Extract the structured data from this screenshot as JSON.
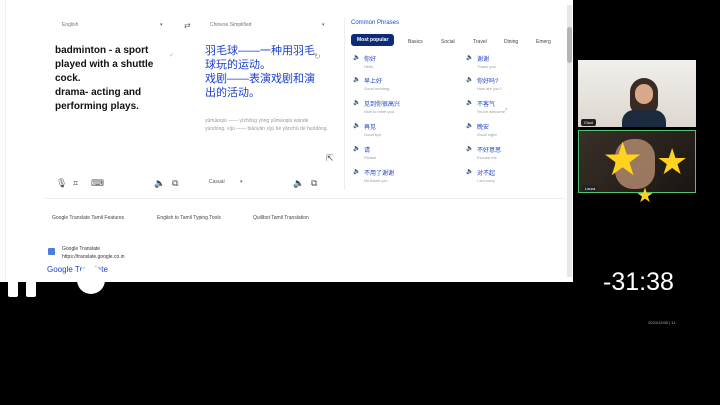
{
  "translator": {
    "source_lang": "English",
    "target_lang": "Chinese Simplified",
    "source_lines": [
      "badminton - a sport",
      "played with a shuttle",
      "cock.",
      "drama- acting and",
      "performing plays."
    ],
    "target_lines": [
      "羽毛球——一种用羽毛",
      "球玩的运动。",
      "戏剧——表演戏剧和演",
      "出的活动。"
    ],
    "romanization": "yǔmáoqiú —— yīzhǒng yòng yǔmáoqiú wánde yùndòng. xìjù —— biǎoyǎn xìjù hé yǎnchū de huódòng.",
    "tone": "Casual"
  },
  "phrases": {
    "title": "Common Phrases",
    "tabs": [
      "Most popular",
      "Basics",
      "Social",
      "Travel",
      "Dining",
      "Emerg"
    ],
    "items": [
      {
        "zh": "你好",
        "en": "Hello"
      },
      {
        "zh": "早上好",
        "en": "Good morning"
      },
      {
        "zh": "见到你很高兴",
        "en": "Nice to meet you"
      },
      {
        "zh": "再见",
        "en": "Good bye"
      },
      {
        "zh": "请",
        "en": "Please"
      },
      {
        "zh": "不用了谢谢",
        "en": "No thank you"
      },
      {
        "zh": "谢谢",
        "en": "Thank you"
      },
      {
        "zh": "你好吗?",
        "en": "How are you?"
      },
      {
        "zh": "不客气",
        "en": "You're welcome"
      },
      {
        "zh": "晚安",
        "en": "Good night"
      },
      {
        "zh": "不好意思",
        "en": "Excuse me"
      },
      {
        "zh": "对不起",
        "en": "I am sorry"
      }
    ]
  },
  "footer_links": [
    "Google Translate Tamil Features",
    "English to Tamil Typing Tools",
    "Quillbot Tamil Translation"
  ],
  "site": {
    "name": "Google Translate",
    "url": "https://translate.google.co.in",
    "bottom_text": "Google Translate"
  },
  "participants": [
    {
      "name": "Cluxi"
    },
    {
      "name": "Laura"
    }
  ],
  "video": {
    "time_remaining": "-31:38",
    "timestamp": "2024/12/05 | 11"
  },
  "colors": {
    "accent": "#1a3fc9",
    "active_tab": "#0d2a78",
    "star": "#ffd21f",
    "speaking_border": "#52c26b"
  }
}
